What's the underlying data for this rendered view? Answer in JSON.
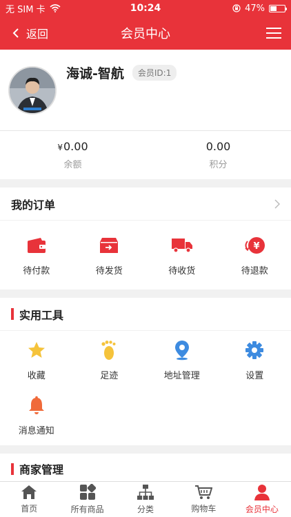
{
  "status_bar": {
    "carrier": "无 SIM 卡",
    "time": "10:24",
    "battery": "47%",
    "battery_level": 0.47
  },
  "nav": {
    "back_label": "返回",
    "title": "会员中心"
  },
  "profile": {
    "name": "海诚-智航",
    "member_id": "会员ID:1"
  },
  "balance": {
    "currency": "¥",
    "amount": "0.00",
    "amount_label": "余额",
    "points": "0.00",
    "points_label": "积分"
  },
  "orders": {
    "title": "我的订单",
    "items": [
      {
        "label": "待付款",
        "icon": "wallet-icon"
      },
      {
        "label": "待发货",
        "icon": "box-icon"
      },
      {
        "label": "待收货",
        "icon": "truck-icon"
      },
      {
        "label": "待退款",
        "icon": "refund-icon"
      }
    ]
  },
  "tools": {
    "title": "实用工具",
    "items": [
      {
        "label": "收藏",
        "icon": "star-icon"
      },
      {
        "label": "足迹",
        "icon": "footprint-icon"
      },
      {
        "label": "地址管理",
        "icon": "location-icon"
      },
      {
        "label": "设置",
        "icon": "gear-icon"
      },
      {
        "label": "消息通知",
        "icon": "bell-icon"
      }
    ]
  },
  "merchant": {
    "title": "商家管理"
  },
  "tabbar": {
    "items": [
      {
        "label": "首页",
        "icon": "home-icon"
      },
      {
        "label": "所有商品",
        "icon": "grid-icon"
      },
      {
        "label": "分类",
        "icon": "category-icon"
      },
      {
        "label": "购物车",
        "icon": "cart-icon"
      },
      {
        "label": "会员中心",
        "icon": "user-icon"
      }
    ],
    "active": "会员中心"
  },
  "colors": {
    "accent": "#e8333a",
    "star": "#f5c33b",
    "blue": "#3d8be0",
    "bell": "#f06a3a"
  }
}
